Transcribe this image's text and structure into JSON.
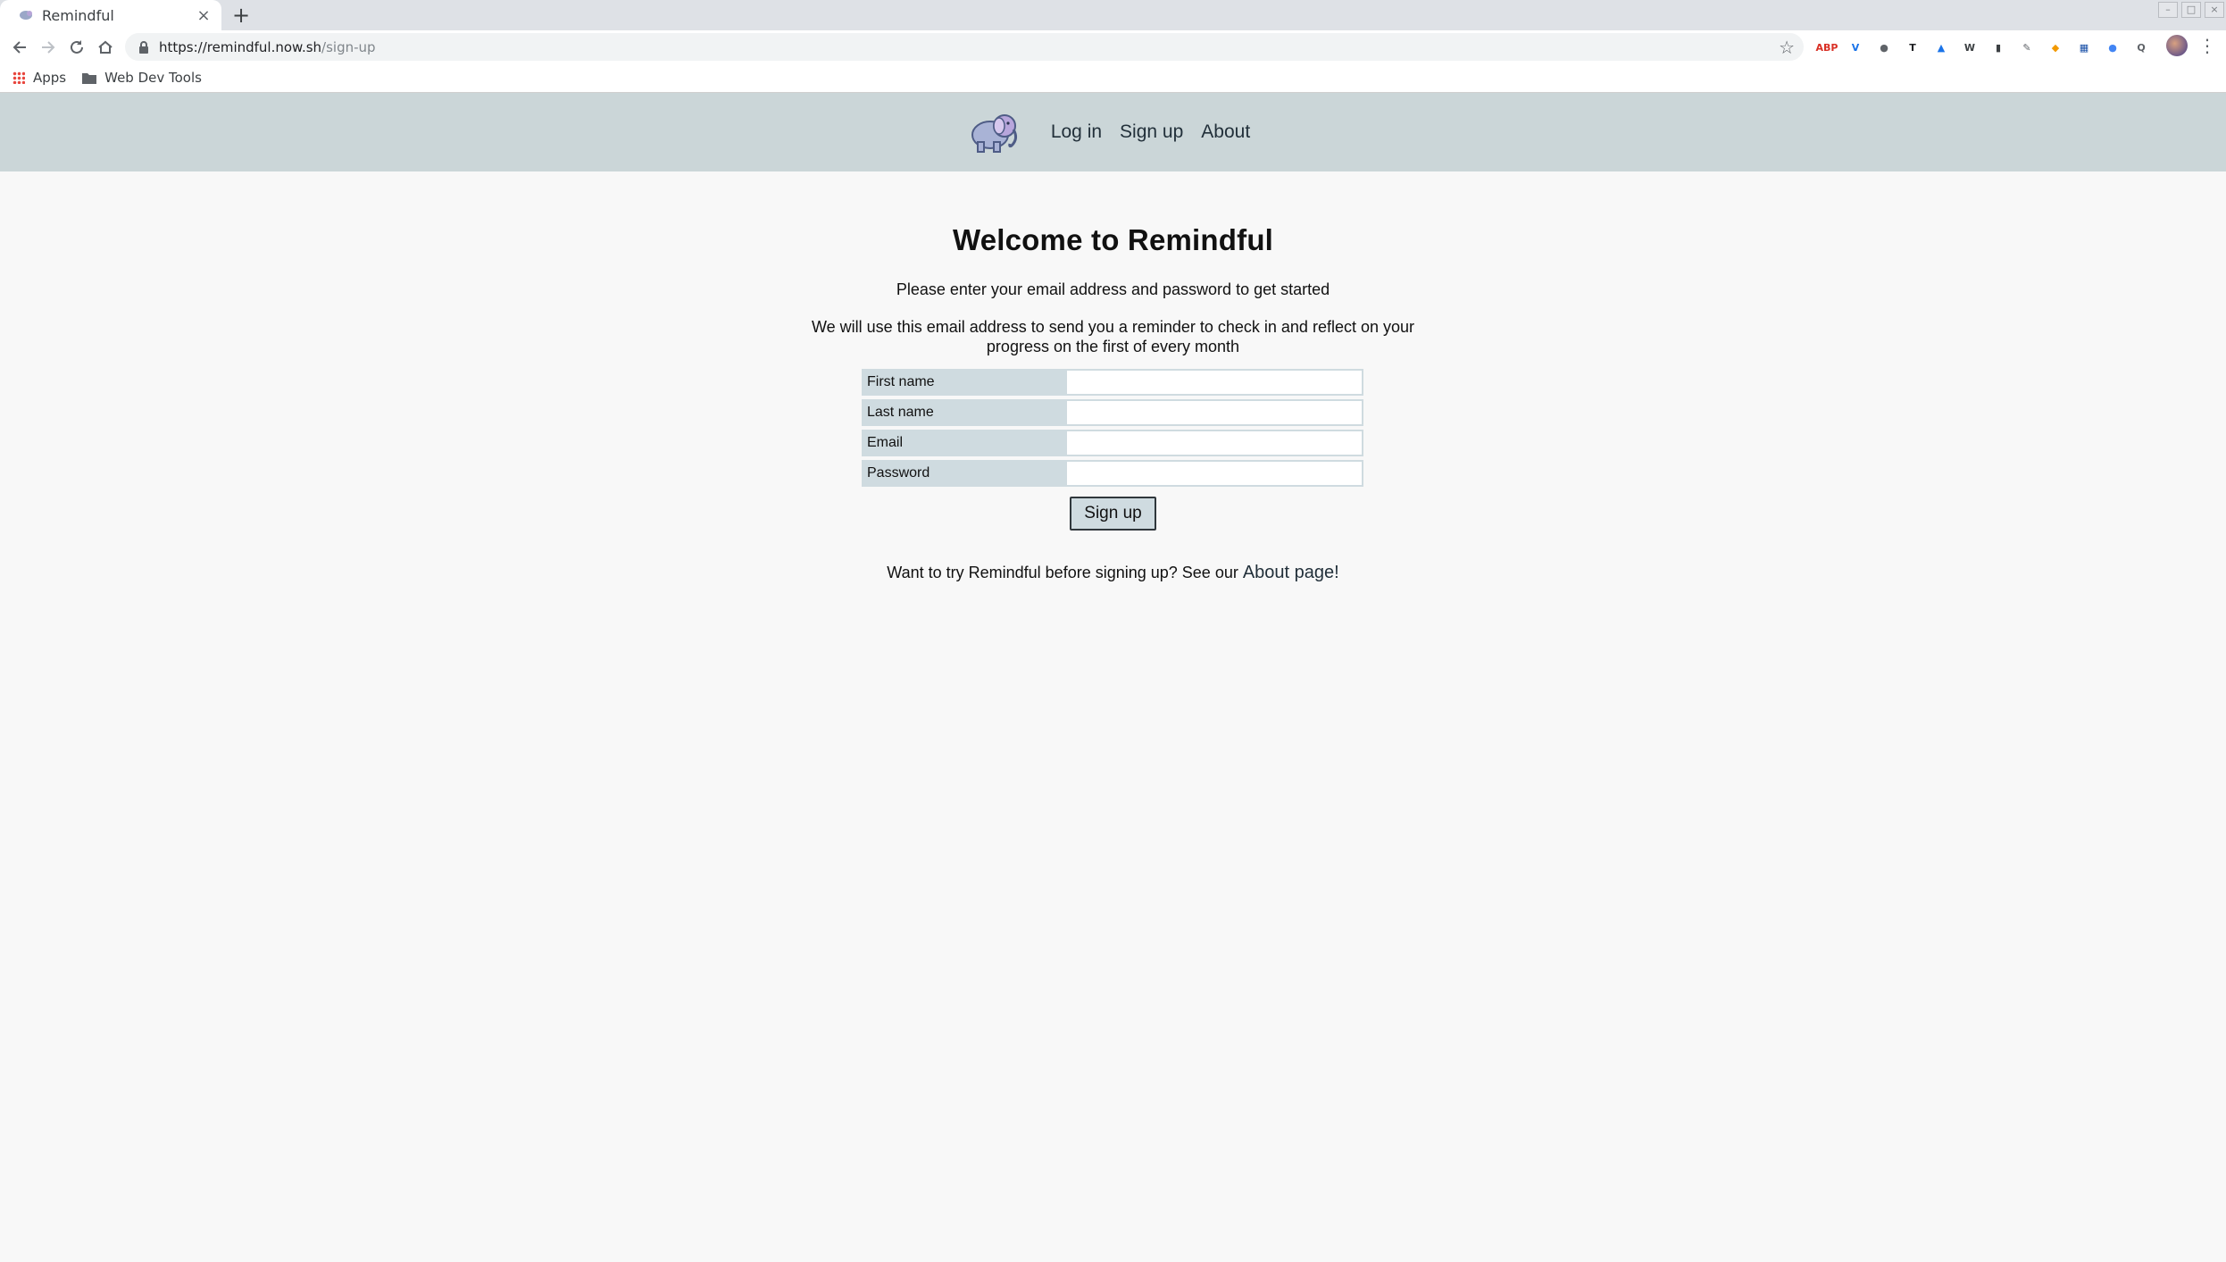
{
  "browser": {
    "tab": {
      "title": "Remindful",
      "close_glyph": "×"
    },
    "new_tab_glyph": "+",
    "url": {
      "host": "https://remindful.now.sh",
      "path": "/sign-up"
    },
    "bookmarks": [
      {
        "label": "Apps",
        "icon": "apps-icon"
      },
      {
        "label": "Web Dev Tools",
        "icon": "folder-icon"
      }
    ],
    "extensions": [
      {
        "icon": "adblock-icon",
        "color": "#d93025",
        "glyph": "ABP"
      },
      {
        "icon": "vimeo-icon",
        "color": "#1a73e8",
        "glyph": "V"
      },
      {
        "icon": "microphone-icon",
        "color": "#5f6368",
        "glyph": "●"
      },
      {
        "icon": "typography-icon",
        "color": "#202124",
        "glyph": "T"
      },
      {
        "icon": "triangle-icon",
        "color": "#1a73e8",
        "glyph": "▲"
      },
      {
        "icon": "wordpress-icon",
        "color": "#3c4043",
        "glyph": "W"
      },
      {
        "icon": "bookmark-icon",
        "color": "#3c4043",
        "glyph": "▮"
      },
      {
        "icon": "eyedropper-icon",
        "color": "#5f6368",
        "glyph": "✎"
      },
      {
        "icon": "shield-icon",
        "color": "#f29900",
        "glyph": "◆"
      },
      {
        "icon": "grid-icon",
        "color": "#174ea6",
        "glyph": "▦"
      },
      {
        "icon": "edge-icon",
        "color": "#4285f4",
        "glyph": "●"
      },
      {
        "icon": "lens-icon",
        "color": "#5f6368",
        "glyph": "Q"
      }
    ]
  },
  "header": {
    "nav": [
      {
        "label": "Log in"
      },
      {
        "label": "Sign up"
      },
      {
        "label": "About"
      }
    ]
  },
  "main": {
    "title": "Welcome to Remindful",
    "lead": "Please enter your email address and password to get started",
    "info": "We will use this email address to send you a reminder to check in and reflect on your progress on the first of every month",
    "form": {
      "fields": [
        {
          "label": "First name",
          "value": ""
        },
        {
          "label": "Last name",
          "value": ""
        },
        {
          "label": "Email",
          "value": ""
        },
        {
          "label": "Password",
          "value": ""
        }
      ],
      "submit_label": "Sign up"
    },
    "footer_text": "Want to try Remindful before signing up? See our ",
    "footer_link": "About page!"
  },
  "colors": {
    "header_bg": "#cbd6d8",
    "label_bg": "#cfdbe0",
    "page_bg": "#f8f8f8"
  }
}
